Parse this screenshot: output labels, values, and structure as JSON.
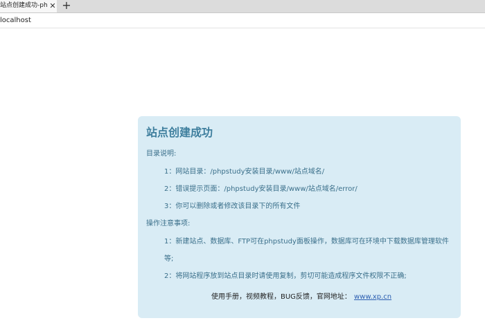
{
  "browser": {
    "tab_title": "站点创建成功-phpstudy for windows",
    "close_glyph": "✕",
    "new_tab_glyph": "+",
    "url": "localhost"
  },
  "panel": {
    "title": "站点创建成功",
    "dir_heading": "目录说明:",
    "dir_items": [
      "1：网站目录：/phpstudy安装目录/www/站点域名/",
      "2：错误提示页面：/phpstudy安装目录/www/站点域名/error/",
      "3：你可以删除或者修改该目录下的所有文件"
    ],
    "notes_heading": "操作注意事项:",
    "notes_items": [
      "1：新建站点、数据库、FTP可在phpstudy面板操作，数据库可在环境中下载数据库管理软件",
      "等;",
      "2：将网站程序放到站点目录时请使用复制，剪切可能造成程序文件权限不正确;"
    ],
    "footer_text": "使用手册，视频教程，BUG反馈，官网地址：",
    "footer_link": "www.xp.cn"
  }
}
